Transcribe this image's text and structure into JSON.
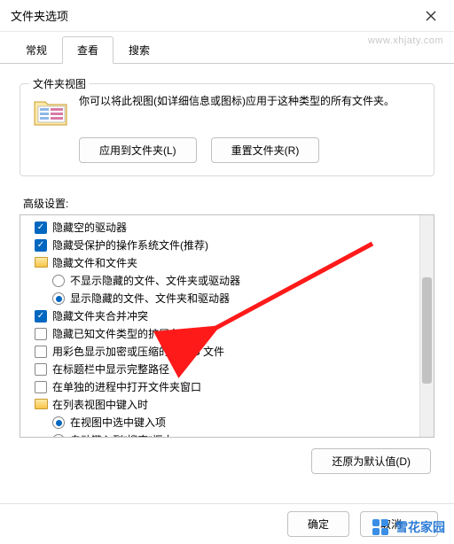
{
  "window": {
    "title": "文件夹选项"
  },
  "tabs": {
    "general": "常规",
    "view": "查看",
    "search": "搜索",
    "active": "view"
  },
  "folder_views": {
    "group_title": "文件夹视图",
    "desc": "你可以将此视图(如详细信息或图标)应用于这种类型的所有文件夹。",
    "apply_btn": "应用到文件夹(L)",
    "reset_btn": "重置文件夹(R)"
  },
  "advanced": {
    "label": "高级设置:",
    "items": [
      {
        "kind": "check",
        "indent": 1,
        "checked": true,
        "label": "隐藏空的驱动器"
      },
      {
        "kind": "check",
        "indent": 1,
        "checked": true,
        "label": "隐藏受保护的操作系统文件(推荐)"
      },
      {
        "kind": "folder",
        "indent": 1,
        "label": "隐藏文件和文件夹"
      },
      {
        "kind": "radio",
        "indent": 2,
        "checked": false,
        "label": "不显示隐藏的文件、文件夹或驱动器"
      },
      {
        "kind": "radio",
        "indent": 2,
        "checked": true,
        "label": "显示隐藏的文件、文件夹和驱动器"
      },
      {
        "kind": "check",
        "indent": 1,
        "checked": true,
        "label": "隐藏文件夹合并冲突"
      },
      {
        "kind": "check",
        "indent": 1,
        "checked": false,
        "label": "隐藏已知文件类型的扩展名"
      },
      {
        "kind": "check",
        "indent": 1,
        "checked": false,
        "label": "用彩色显示加密或压缩的 NTFS 文件"
      },
      {
        "kind": "check",
        "indent": 1,
        "checked": false,
        "label": "在标题栏中显示完整路径"
      },
      {
        "kind": "check",
        "indent": 1,
        "checked": false,
        "label": "在单独的进程中打开文件夹窗口"
      },
      {
        "kind": "folder",
        "indent": 1,
        "label": "在列表视图中键入时"
      },
      {
        "kind": "radio",
        "indent": 2,
        "checked": true,
        "label": "在视图中选中键入项"
      },
      {
        "kind": "radio",
        "indent": 2,
        "checked": false,
        "label": "自动键入到\"搜索\"框中"
      }
    ],
    "restore_btn": "还原为默认值(D)"
  },
  "footer": {
    "ok": "确定",
    "cancel": "取消"
  },
  "watermark": {
    "text": "雪花家园",
    "url": "www.xhjaty.com"
  }
}
